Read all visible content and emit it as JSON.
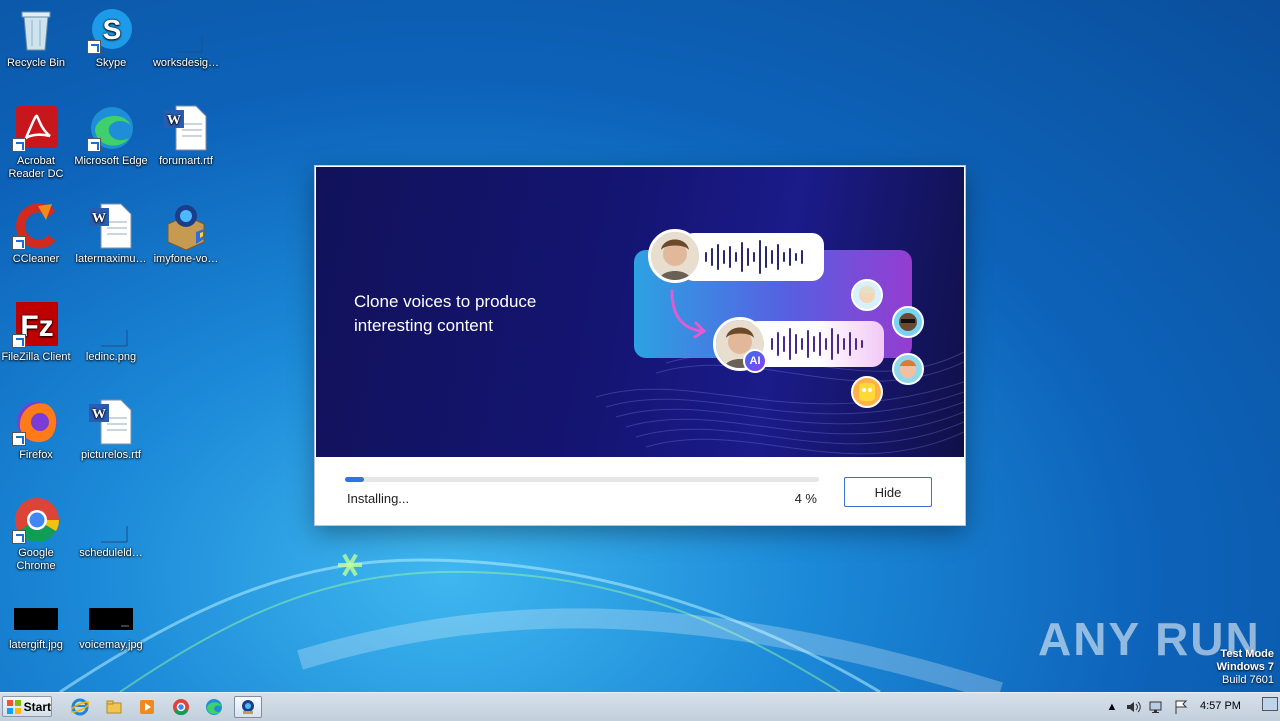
{
  "desktop": {
    "icons": [
      {
        "label": "Recycle Bin",
        "icon": "recycle-bin-icon"
      },
      {
        "label": "Skype",
        "icon": "skype-icon"
      },
      {
        "label": "worksdesig…",
        "icon": "blank-file-icon"
      },
      {
        "label": "Acrobat Reader DC",
        "icon": "acrobat-icon"
      },
      {
        "label": "Microsoft Edge",
        "icon": "edge-icon"
      },
      {
        "label": "forumart.rtf",
        "icon": "word-doc-icon"
      },
      {
        "label": "CCleaner",
        "icon": "ccleaner-icon"
      },
      {
        "label": "latermaximu…",
        "icon": "word-doc-icon"
      },
      {
        "label": "imyfone-vo…",
        "icon": "installer-icon"
      },
      {
        "label": "FileZilla Client",
        "icon": "filezilla-icon"
      },
      {
        "label": "ledinc.png",
        "icon": "blank-file-icon"
      },
      {
        "label": "Firefox",
        "icon": "firefox-icon"
      },
      {
        "label": "picturelos.rtf",
        "icon": "word-doc-icon"
      },
      {
        "label": "Google Chrome",
        "icon": "chrome-icon"
      },
      {
        "label": "scheduleld…",
        "icon": "blank-file-icon"
      },
      {
        "label": "latergift.jpg",
        "icon": "black-image-icon"
      },
      {
        "label": "voicemay.jpg",
        "icon": "black-image-icon"
      }
    ],
    "watermark": "ANY RUN",
    "test_mode": [
      "Test Mode",
      "Windows 7",
      "Build 7601"
    ]
  },
  "installer": {
    "banner_title": "Clone voices to produce interesting content",
    "ai_badge": "AI",
    "status": "Installing...",
    "progress_percent": 4,
    "progress_text": "4 %",
    "hide_label": "Hide"
  },
  "taskbar": {
    "start_label": "Start",
    "pinned": [
      "ie-icon",
      "explorer-icon",
      "media-player-icon",
      "chrome-icon",
      "edge-icon",
      "installer-icon"
    ],
    "clock": "4:57 PM"
  },
  "colors": {
    "accent": "#2f74e4",
    "banner_bg": "#141472"
  }
}
